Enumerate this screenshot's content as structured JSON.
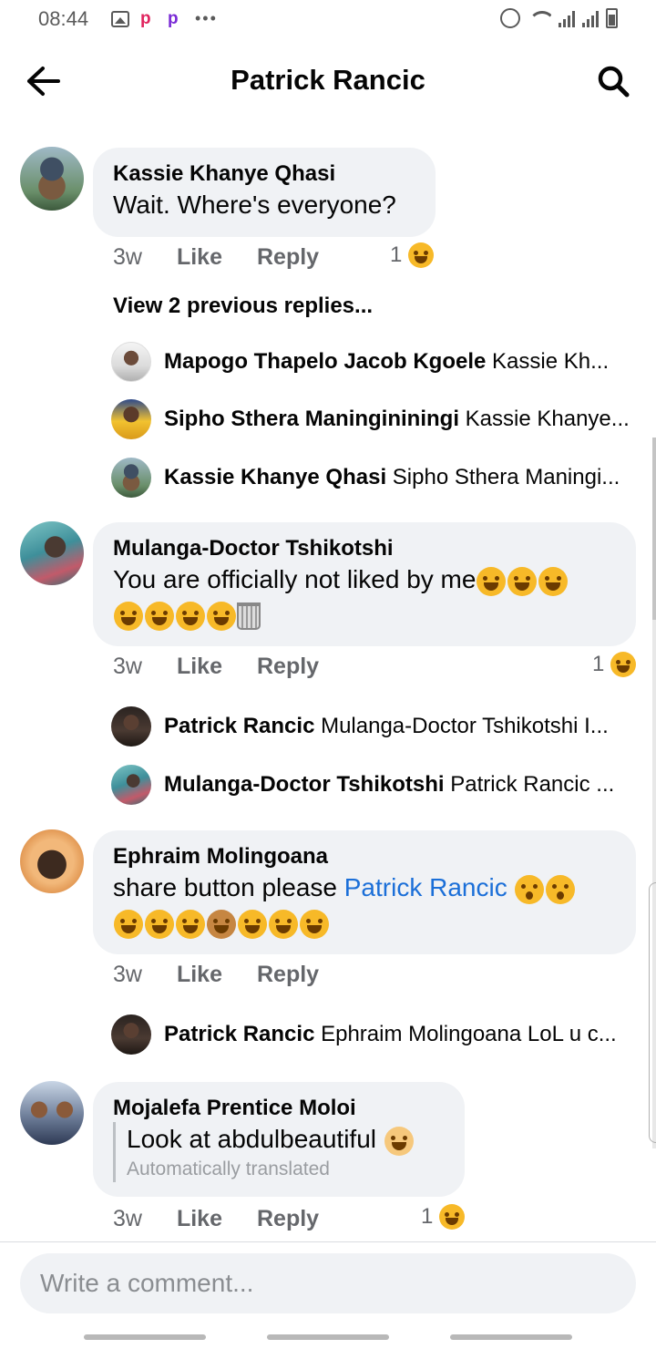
{
  "status_bar": {
    "time": "08:44",
    "icons": [
      "gallery-icon",
      "pocket-p-icon",
      "pocket-p-icon",
      "more-dots-icon",
      "alarm-icon",
      "wifi-icon",
      "signal-icon",
      "signal-icon",
      "battery-icon"
    ],
    "more_dots": "•••"
  },
  "header": {
    "title": "Patrick Rancic",
    "back_icon": "arrow-left-icon",
    "search_icon": "search-icon"
  },
  "comments": [
    {
      "author": "Kassie Khanye Qhasi",
      "text": "Wait. Where's everyone?",
      "time": "3w",
      "like": "Like",
      "reply": "Reply",
      "reaction_count": "1",
      "reaction": "haha",
      "view_previous": "View 2 previous replies...",
      "replies": [
        {
          "author": "Mapogo Thapelo Jacob Kgoele",
          "text": "Kassie Kh..."
        },
        {
          "author": "Sipho Sthera Maningininingi",
          "text": "Kassie Khanye..."
        },
        {
          "author": "Kassie Khanye Qhasi",
          "text": "Sipho Sthera Maningi..."
        }
      ]
    },
    {
      "author": "Mulanga-Doctor Tshikotshi",
      "text": "You are officially not liked by me",
      "emojis": [
        "joy",
        "joy",
        "joy",
        "joy",
        "joy",
        "joy",
        "joy",
        "wastebasket"
      ],
      "time": "3w",
      "like": "Like",
      "reply": "Reply",
      "reaction_count": "1",
      "reaction": "haha",
      "replies": [
        {
          "author": "Patrick Rancic",
          "text": "Mulanga-Doctor Tshikotshi I..."
        },
        {
          "author": "Mulanga-Doctor Tshikotshi",
          "text": "Patrick Rancic ..."
        }
      ]
    },
    {
      "author": "Ephraim Molingoana",
      "text": "share button please ",
      "mention": "Patrick Rancic",
      "emojis": [
        "flushed",
        "flushed",
        "rofl",
        "rofl",
        "rofl",
        "see-no-evil",
        "joy",
        "joy",
        "joy"
      ],
      "time": "3w",
      "like": "Like",
      "reply": "Reply",
      "replies": [
        {
          "author": "Patrick Rancic",
          "text": "Ephraim Molingoana LoL u c..."
        }
      ]
    },
    {
      "author": "Mojalefa Prentice Moloi",
      "text": "Look at abdulbeautiful",
      "emojis": [
        "baby"
      ],
      "translated_note": "Automatically translated",
      "time": "3w",
      "like": "Like",
      "reply": "Reply",
      "reaction_count": "1",
      "reaction": "haha"
    }
  ],
  "composer": {
    "placeholder": "Write a comment..."
  },
  "colors": {
    "bubble": "#f0f2f5",
    "link": "#1b6fd8",
    "meta": "#65676b",
    "reaction": "#f7b928"
  }
}
